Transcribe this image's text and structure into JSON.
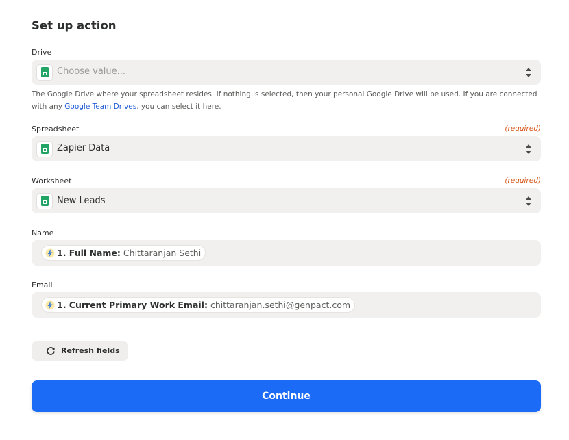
{
  "section_title": "Set up action",
  "drive": {
    "label": "Drive",
    "placeholder": "Choose value...",
    "icon": "google-sheets-icon",
    "help_text_before": "The Google Drive where your spreadsheet resides. If nothing is selected, then your personal Google Drive will be used. If you are connected with any ",
    "help_link": "Google Team Drives",
    "help_text_after": ", you can select it here."
  },
  "spreadsheet": {
    "label": "Spreadsheet",
    "required": "(required)",
    "value": "Zapier Data",
    "icon": "google-sheets-icon"
  },
  "worksheet": {
    "label": "Worksheet",
    "required": "(required)",
    "value": "New Leads",
    "icon": "google-sheets-icon"
  },
  "name_field": {
    "label": "Name",
    "pill_key": "1. Full Name:",
    "pill_value": "Chittaranjan Sethi"
  },
  "email_field": {
    "label": "Email",
    "pill_key": "1. Current Primary Work Email:",
    "pill_value": "chittaranjan.sethi@genpact.com"
  },
  "refresh_button": {
    "label": "Refresh fields",
    "icon": "refresh-icon"
  },
  "continue_button": {
    "label": "Continue"
  },
  "colors": {
    "accent": "#1c6bf7",
    "required": "#d9581c",
    "link": "#1f5bd6",
    "sheets_green": "#21a464"
  }
}
